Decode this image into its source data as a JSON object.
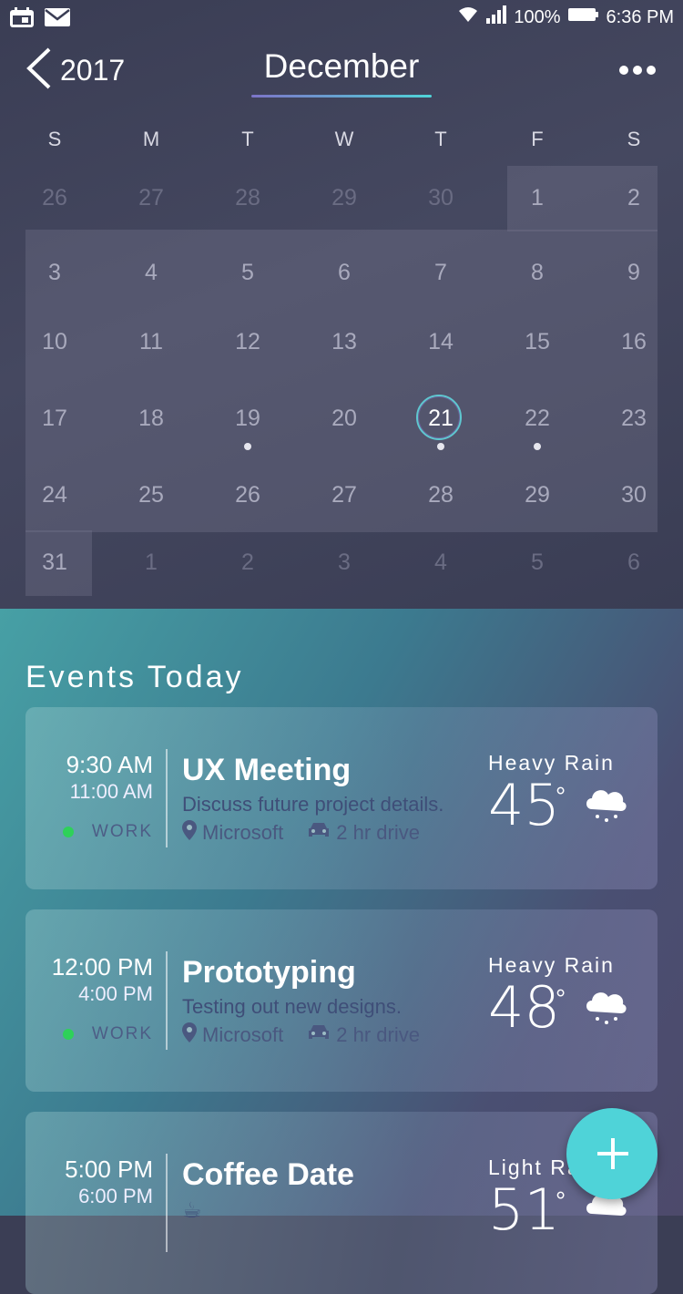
{
  "status_bar": {
    "battery": "100%",
    "time": "6:36 PM"
  },
  "header": {
    "back_year": "2017",
    "month": "December"
  },
  "calendar": {
    "weekdays": [
      "S",
      "M",
      "T",
      "W",
      "T",
      "F",
      "S"
    ],
    "rows": [
      [
        "26",
        "27",
        "28",
        "29",
        "30",
        "1",
        "2"
      ],
      [
        "3",
        "4",
        "5",
        "6",
        "7",
        "8",
        "9"
      ],
      [
        "10",
        "11",
        "12",
        "13",
        "14",
        "15",
        "16"
      ],
      [
        "17",
        "18",
        "19",
        "20",
        "21",
        "22",
        "23"
      ],
      [
        "24",
        "25",
        "26",
        "27",
        "28",
        "29",
        "30"
      ],
      [
        "31",
        "1",
        "2",
        "3",
        "4",
        "5",
        "6"
      ]
    ],
    "selected_day": "21",
    "days_with_events": [
      "19",
      "21",
      "22"
    ]
  },
  "events": {
    "title": "Events Today",
    "items": [
      {
        "start": "9:30 AM",
        "end": "11:00 AM",
        "tag": "WORK",
        "title": "UX Meeting",
        "desc": "Discuss future project details.",
        "location": "Microsoft",
        "drive": "2 hr drive",
        "weather": "Heavy Rain",
        "temp": "45"
      },
      {
        "start": "12:00 PM",
        "end": "4:00 PM",
        "tag": "WORK",
        "title": "Prototyping",
        "desc": "Testing out new designs.",
        "location": "Microsoft",
        "drive": "2 hr drive",
        "weather": "Heavy Rain",
        "temp": "48"
      },
      {
        "start": "5:00 PM",
        "end": "6:00 PM",
        "title": "Coffee Date",
        "desc": "☕",
        "weather": "Light Rain",
        "temp": "51"
      }
    ]
  },
  "colors": {
    "accent": "#4fd3d8",
    "work_dot": "#2ed159"
  }
}
